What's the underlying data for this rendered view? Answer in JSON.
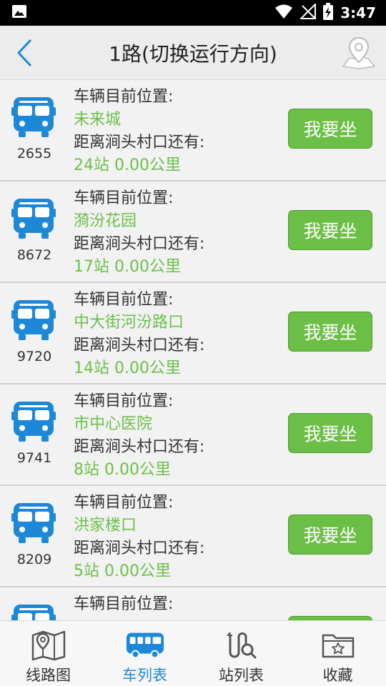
{
  "status_bar": {
    "time": "3:47"
  },
  "header": {
    "title": "1路(切换运行方向)"
  },
  "colors": {
    "accent_blue": "#1e88d8",
    "green": "#6cc04a",
    "button_green": "#6cbf46"
  },
  "vehicles": [
    {
      "bus_id": "2655",
      "position_label": "车辆目前位置:",
      "position": "未来城",
      "distance_label": "距离涧头村口还有:",
      "distance": "24站  0.00公里",
      "button": "我要坐"
    },
    {
      "bus_id": "8672",
      "position_label": "车辆目前位置:",
      "position": "漪汾花园",
      "distance_label": "距离涧头村口还有:",
      "distance": "17站  0.00公里",
      "button": "我要坐"
    },
    {
      "bus_id": "9720",
      "position_label": "车辆目前位置:",
      "position": "中大街河汾路口",
      "distance_label": "距离涧头村口还有:",
      "distance": "14站  0.00公里",
      "button": "我要坐"
    },
    {
      "bus_id": "9741",
      "position_label": "车辆目前位置:",
      "position": "市中心医院",
      "distance_label": "距离涧头村口还有:",
      "distance": "8站  0.00公里",
      "button": "我要坐"
    },
    {
      "bus_id": "8209",
      "position_label": "车辆目前位置:",
      "position": "洪家楼口",
      "distance_label": "距离涧头村口还有:",
      "distance": "5站  0.00公里",
      "button": "我要坐"
    },
    {
      "position_label": "车辆目前位置:"
    }
  ],
  "bottom_nav": [
    {
      "label": "线路图",
      "icon": "map-icon"
    },
    {
      "label": "车列表",
      "icon": "bus-icon"
    },
    {
      "label": "站列表",
      "icon": "route-search-icon"
    },
    {
      "label": "收藏",
      "icon": "favorites-folder-icon"
    }
  ]
}
